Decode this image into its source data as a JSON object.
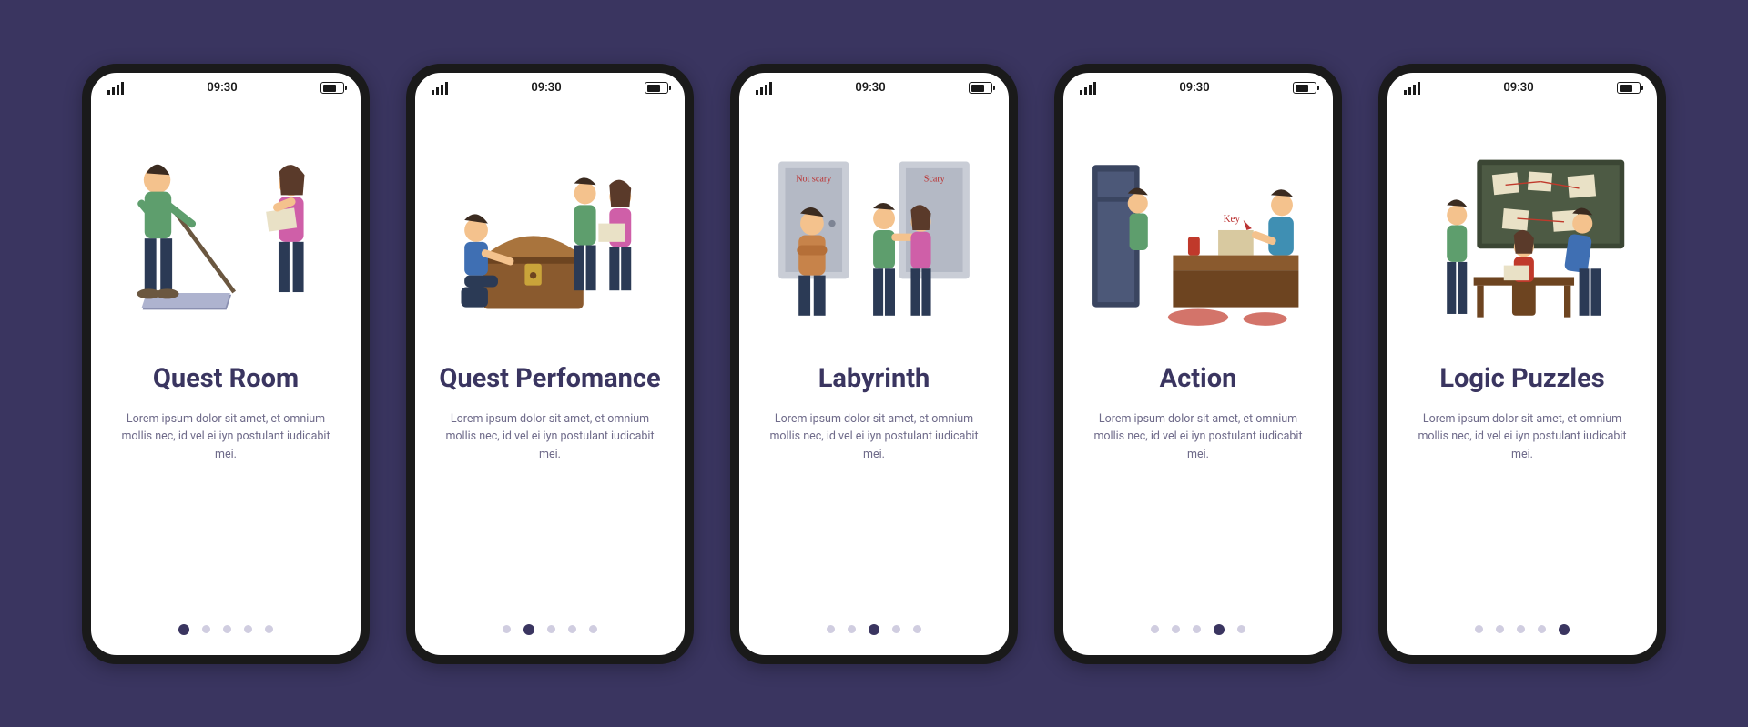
{
  "status": {
    "time": "09:30"
  },
  "description": "Lorem ipsum dolor sit amet, et omnium mollis nec, id vel ei iyn postulant iudicabit mei.",
  "screens": [
    {
      "title": "Quest Room",
      "active_dot": 0
    },
    {
      "title": "Quest Perfomance",
      "active_dot": 1
    },
    {
      "title": "Labyrinth",
      "active_dot": 2
    },
    {
      "title": "Action",
      "active_dot": 3
    },
    {
      "title": "Logic Puzzles",
      "active_dot": 4
    }
  ],
  "dot_count": 5,
  "illustrations": {
    "labyrinth_doors": {
      "left_label": "Not scary",
      "right_label": "Scary"
    },
    "action_mark": "Key"
  },
  "colors": {
    "bg": "#3a3560",
    "title": "#3a3560",
    "text": "#6f6b8a",
    "dot_inactive": "#d0cde0",
    "frame": "#1a1a1a"
  }
}
